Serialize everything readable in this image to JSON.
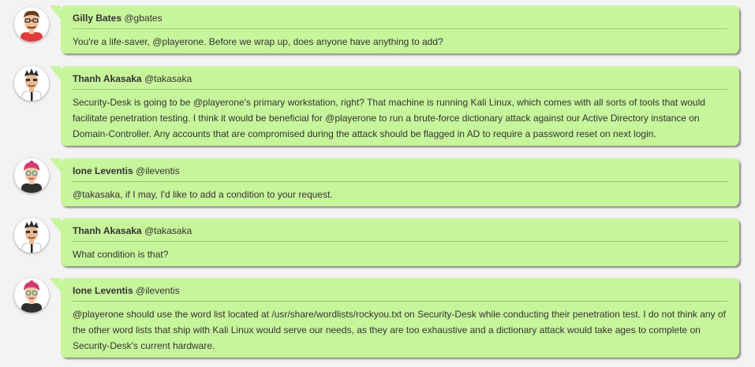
{
  "messages": [
    {
      "avatar": "gilly-avatar",
      "name": "Gilly Bates",
      "handle": "@gbates",
      "text": "You're a life-saver, @playerone. Before we wrap up, does anyone have anything to add?"
    },
    {
      "avatar": "thanh-avatar",
      "name": "Thanh Akasaka",
      "handle": "@takasaka",
      "text": "Security-Desk is going to be @playerone's primary workstation, right? That machine is running Kali Linux, which comes with all sorts of tools that would facilitate penetration testing. I think it would be beneficial for @playerone to run a brute-force dictionary attack against our Active Directory instance on Domain-Controller. Any accounts that are compromised during the attack should be flagged in AD to require a password reset on next login."
    },
    {
      "avatar": "ione-avatar",
      "name": "Ione Leventis",
      "handle": "@ileventis",
      "text": "@takasaka, if I may, I'd like to add a condition to your request."
    },
    {
      "avatar": "thanh-avatar",
      "name": "Thanh Akasaka",
      "handle": "@takasaka",
      "text": "What condition is that?"
    },
    {
      "avatar": "ione-avatar",
      "name": "Ione Leventis",
      "handle": "@ileventis",
      "text": "@playerone should use the word list located at /usr/share/wordlists/rockyou.txt on Security-Desk while conducting their penetration test. I do not think any of the other word lists that ship with Kali Linux would serve our needs, as they are too exhaustive and a dictionary attack would take ages to complete on Security-Desk's current hardware."
    }
  ],
  "colors": {
    "bubble": "#c7f59b",
    "divider": "#9fc27f",
    "background": "#f3f3f3"
  }
}
